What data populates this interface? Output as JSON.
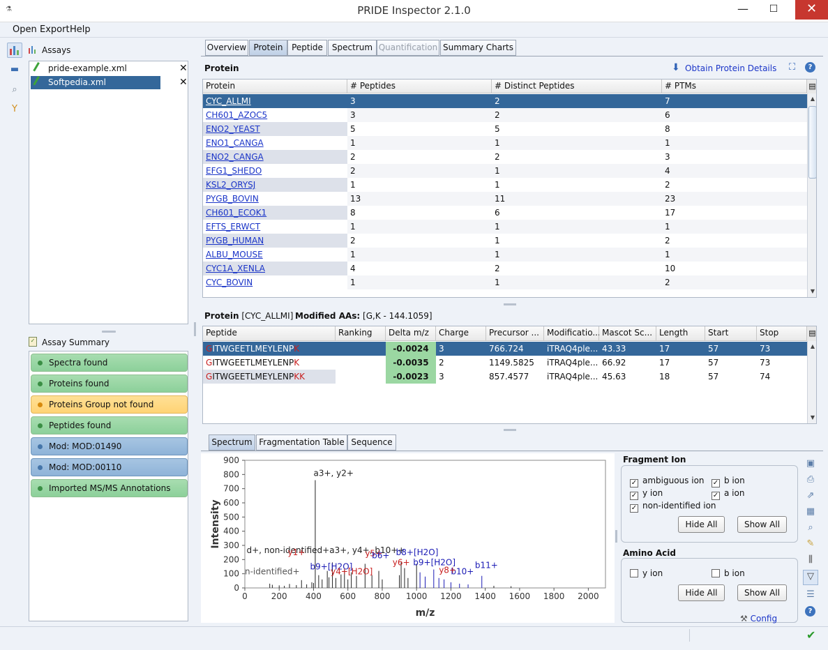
{
  "window": {
    "title": "PRIDE Inspector 2.1.0",
    "minimize": "—",
    "maximize": "☐",
    "close": "✕"
  },
  "menu": {
    "open": "Open",
    "export": "Export",
    "help": "Help"
  },
  "sidebar": {
    "assays_title": "Assays",
    "assays": [
      {
        "name": "pride-example.xml"
      },
      {
        "name": "Softpedia.xml"
      }
    ],
    "summary_title": "Assay Summary",
    "summary_items": [
      {
        "label": "Spectra found",
        "status": "ok"
      },
      {
        "label": "Proteins found",
        "status": "ok"
      },
      {
        "label": "Proteins Group not found",
        "status": "warn"
      },
      {
        "label": "Peptides found",
        "status": "ok"
      },
      {
        "label": "Mod: MOD:01490",
        "status": "info"
      },
      {
        "label": "Mod: MOD:00110",
        "status": "info"
      },
      {
        "label": "Imported MS/MS Annotations",
        "status": "ok"
      }
    ]
  },
  "tabs": [
    "Overview",
    "Protein",
    "Peptide",
    "Spectrum",
    "Quantification",
    "Summary Charts"
  ],
  "protein_panel": {
    "title": "Protein",
    "obtain": "Obtain Protein Details",
    "columns": [
      "Protein",
      "# Peptides",
      "# Distinct Peptides",
      "# PTMs"
    ],
    "rows": [
      [
        "CYC_ALLMI",
        "3",
        "2",
        "7"
      ],
      [
        "CH601_AZOC5",
        "3",
        "2",
        "6"
      ],
      [
        "ENO2_YEAST",
        "5",
        "5",
        "8"
      ],
      [
        "ENO1_CANGA",
        "1",
        "1",
        "1"
      ],
      [
        "ENO2_CANGA",
        "2",
        "2",
        "3"
      ],
      [
        "EFG1_SHEDO",
        "2",
        "1",
        "4"
      ],
      [
        "KSL2_ORYSJ",
        "1",
        "1",
        "2"
      ],
      [
        "PYGB_BOVIN",
        "13",
        "11",
        "23"
      ],
      [
        "CH601_ECOK1",
        "8",
        "6",
        "17"
      ],
      [
        "EFTS_ERWCT",
        "1",
        "1",
        "1"
      ],
      [
        "PYGB_HUMAN",
        "2",
        "1",
        "2"
      ],
      [
        "ALBU_MOUSE",
        "1",
        "1",
        "1"
      ],
      [
        "CYC1A_XENLA",
        "4",
        "2",
        "10"
      ],
      [
        "CYC_BOVIN",
        "1",
        "1",
        "2"
      ]
    ]
  },
  "peptide_panel": {
    "title_label": "Protein",
    "protein": "[CYC_ALLMI]",
    "mod_label": "Modified AAs:",
    "mod_value": "[G,K - 144.1059]",
    "columns": [
      "Peptide",
      "Ranking",
      "Delta m/z",
      "Charge",
      "Precursor ...",
      "Modificatio...",
      "Mascot Sc...",
      "Length",
      "Start",
      "Stop"
    ],
    "rows": [
      {
        "first": "G",
        "mid": "ITWGEETLMEYLENP",
        "last": "K",
        "ranking": "",
        "delta": "-0.0024",
        "charge": "3",
        "precursor": "766.724",
        "mod": "iTRAQ4ple...",
        "mascot": "43.33",
        "length": "17",
        "start": "57",
        "stop": "73"
      },
      {
        "first": "G",
        "mid": "ITWGEETLMEYLENP",
        "last": "K",
        "ranking": "",
        "delta": "-0.0035",
        "charge": "2",
        "precursor": "1149.5825",
        "mod": "iTRAQ4ple...",
        "mascot": "66.92",
        "length": "17",
        "start": "57",
        "stop": "73"
      },
      {
        "first": "G",
        "mid": "ITWGEETLMEYLENP",
        "last": "KK",
        "ranking": "",
        "delta": "-0.0023",
        "charge": "3",
        "precursor": "857.4577",
        "mod": "iTRAQ4ple...",
        "mascot": "45.63",
        "length": "18",
        "start": "57",
        "stop": "74"
      }
    ]
  },
  "spectrum_tabs": [
    "Spectrum",
    "Fragmentation Table",
    "Sequence"
  ],
  "chart_data": {
    "type": "bar",
    "xlabel": "m/z",
    "ylabel": "Intensity",
    "xlim": [
      0,
      2100
    ],
    "ylim": [
      0,
      900
    ],
    "xticks": [
      "0",
      "200",
      "400",
      "600",
      "800",
      "1000",
      "1200",
      "1400",
      "1600",
      "1800",
      "2000"
    ],
    "yticks": [
      "0",
      "100",
      "200",
      "300",
      "400",
      "500",
      "600",
      "700",
      "800",
      "900"
    ],
    "peaks": [
      [
        145,
        30
      ],
      [
        160,
        22
      ],
      [
        200,
        18
      ],
      [
        230,
        15
      ],
      [
        260,
        28
      ],
      [
        300,
        20
      ],
      [
        330,
        55
      ],
      [
        360,
        25
      ],
      [
        390,
        40
      ],
      [
        400,
        35
      ],
      [
        410,
        760
      ],
      [
        430,
        90
      ],
      [
        450,
        60
      ],
      [
        480,
        120
      ],
      [
        490,
        75
      ],
      [
        510,
        180
      ],
      [
        530,
        70
      ],
      [
        560,
        95
      ],
      [
        580,
        130
      ],
      [
        600,
        60
      ],
      [
        620,
        110
      ],
      [
        650,
        85
      ],
      [
        700,
        170
      ],
      [
        740,
        90
      ],
      [
        780,
        120
      ],
      [
        800,
        60
      ],
      [
        900,
        90
      ],
      [
        910,
        180
      ],
      [
        930,
        140
      ],
      [
        950,
        70
      ],
      [
        1000,
        170
      ],
      [
        1020,
        110
      ],
      [
        1050,
        80
      ],
      [
        1100,
        130
      ],
      [
        1130,
        70
      ],
      [
        1160,
        60
      ],
      [
        1200,
        40
      ],
      [
        1250,
        30
      ],
      [
        1300,
        25
      ],
      [
        1380,
        85
      ],
      [
        1450,
        15
      ],
      [
        1550,
        12
      ]
    ],
    "annotations": [
      {
        "text": "a3+, y2+",
        "x": 400,
        "y": 790,
        "color": "#222"
      },
      {
        "text": "d+, non-identified+a3+, y4+, b10++",
        "x": 10,
        "y": 245,
        "color": "#222"
      },
      {
        "text": "y1+",
        "x": 250,
        "y": 230,
        "color": "#c82020"
      },
      {
        "text": "y5+",
        "x": 700,
        "y": 225,
        "color": "#c82020"
      },
      {
        "text": "b6+",
        "x": 740,
        "y": 210,
        "color": "#1b1bb5"
      },
      {
        "text": "b8+[H2O]",
        "x": 880,
        "y": 230,
        "color": "#1b1bb5"
      },
      {
        "text": "y6+",
        "x": 860,
        "y": 160,
        "color": "#c82020"
      },
      {
        "text": "b9+[H2O]",
        "x": 980,
        "y": 160,
        "color": "#1b1bb5"
      },
      {
        "text": "b9+[H2O]",
        "x": 380,
        "y": 130,
        "color": "#1b1bb5"
      },
      {
        "text": "b10+",
        "x": 1200,
        "y": 95,
        "color": "#1b1bb5"
      },
      {
        "text": "b11+",
        "x": 1340,
        "y": 140,
        "color": "#1b1bb5"
      },
      {
        "text": "y8+",
        "x": 1130,
        "y": 105,
        "color": "#c82020"
      },
      {
        "text": "y4+[H2O]",
        "x": 500,
        "y": 95,
        "color": "#c82020"
      },
      {
        "text": "n-identified+",
        "x": 0,
        "y": 95,
        "color": "#555"
      }
    ]
  },
  "fragment": {
    "title": "Fragment Ion",
    "checks": [
      {
        "label": "ambiguous ion",
        "checked": "✓"
      },
      {
        "label": "b ion",
        "checked": "✓"
      },
      {
        "label": "y ion",
        "checked": "✓"
      },
      {
        "label": "a ion",
        "checked": "✓"
      },
      {
        "label": "non-identified ion",
        "checked": "✓"
      }
    ],
    "hide": "Hide All",
    "show": "Show All"
  },
  "amino": {
    "title": "Amino Acid",
    "checks": [
      {
        "label": "y ion",
        "checked": ""
      },
      {
        "label": "b ion",
        "checked": ""
      }
    ],
    "hide": "Hide All",
    "show": "Show All",
    "config": "Config"
  },
  "colors": {
    "selection": "#34679a",
    "link": "#1b35c8",
    "accent_green": "#9bd7a2"
  },
  "status": {
    "ok_icon": "check-icon"
  }
}
